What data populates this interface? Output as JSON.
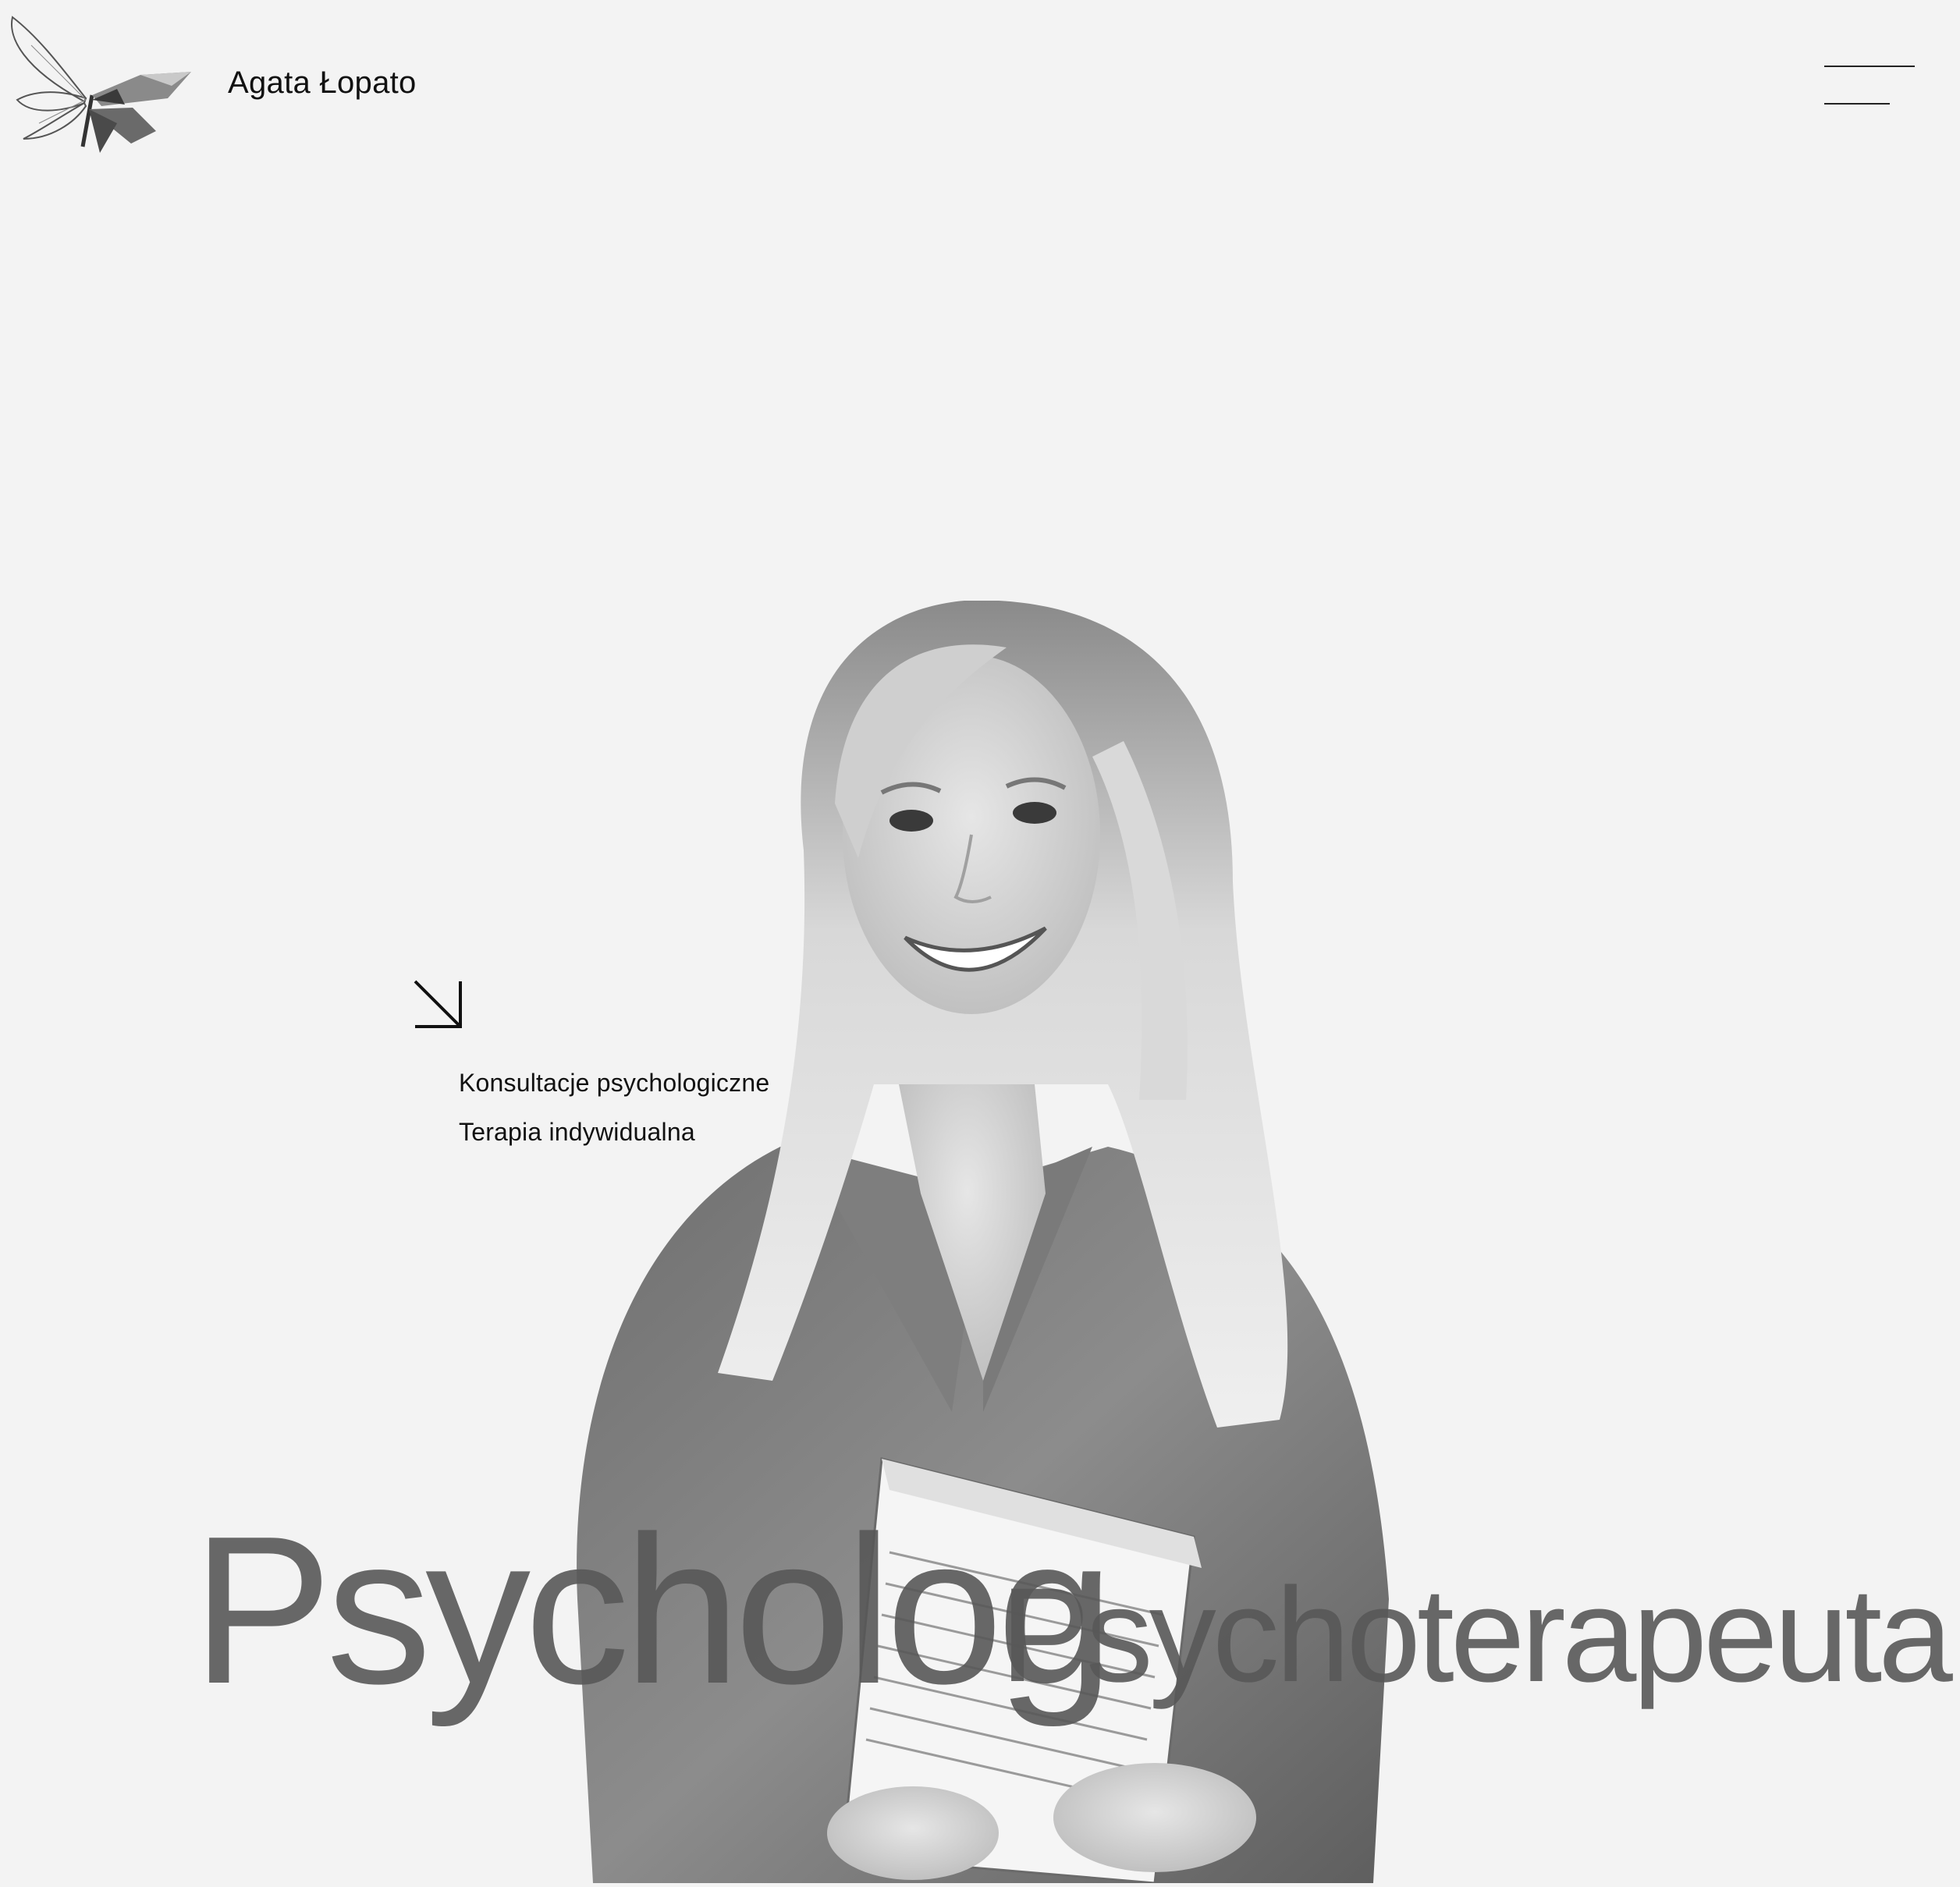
{
  "header": {
    "brand_name": "Agata Łopato",
    "logo_icon": "butterfly-logo-icon",
    "menu_icon": "hamburger-menu-icon"
  },
  "hero": {
    "arrow_icon": "arrow-down-right-icon",
    "services": [
      "Konsultacje psychologiczne",
      "Terapia indywidualna"
    ],
    "title_primary": "Psycholog",
    "title_secondary": "Psychoterapeuta"
  },
  "colors": {
    "background": "#f3f3f3",
    "text": "#111111",
    "title": "#585858"
  }
}
